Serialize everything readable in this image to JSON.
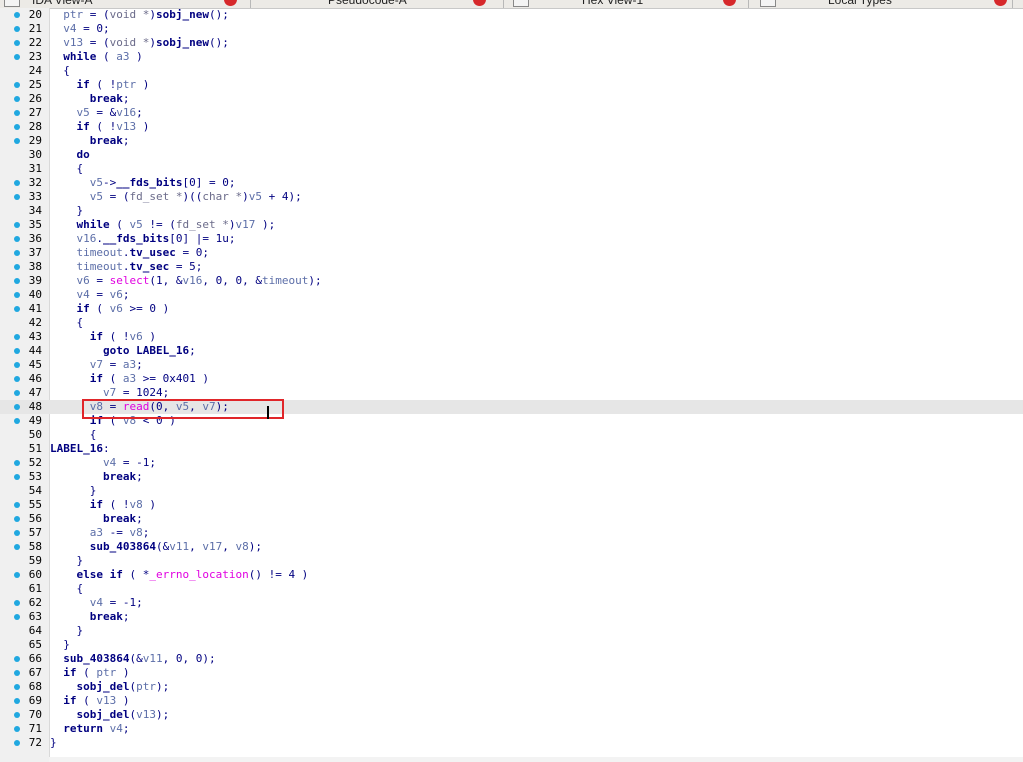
{
  "tabs": [
    {
      "label": "IDA View-A",
      "name": "tab-ida-view-a"
    },
    {
      "label": "Pseudocode-A",
      "name": "tab-pseudocode-a"
    },
    {
      "label": "Hex View-1",
      "name": "tab-hex-view-1"
    },
    {
      "label": "Local Types",
      "name": "tab-local-types"
    }
  ],
  "colors": {
    "gutter_dot": "#20a8e0",
    "highlight_box": "#e0262a",
    "code_text": "#000080",
    "variable": "#5c6ea8",
    "imported_function": "#e000e0",
    "current_line": "#e6e6e6"
  },
  "current_line": 48,
  "highlighted_line": 48,
  "code": [
    {
      "n": "20",
      "dot": true,
      "tokens": [
        [
          "sym",
          "  "
        ],
        [
          "var",
          "ptr"
        ],
        [
          "plain",
          " = ("
        ],
        [
          "typ",
          "void *"
        ],
        [
          "plain",
          ")"
        ],
        [
          "func",
          "sobj_new"
        ],
        [
          "plain",
          "();"
        ]
      ]
    },
    {
      "n": "21",
      "dot": true,
      "tokens": [
        [
          "plain",
          "  "
        ],
        [
          "var",
          "v4"
        ],
        [
          "plain",
          " = 0;"
        ]
      ]
    },
    {
      "n": "22",
      "dot": true,
      "tokens": [
        [
          "plain",
          "  "
        ],
        [
          "var",
          "v13"
        ],
        [
          "plain",
          " = ("
        ],
        [
          "typ",
          "void *"
        ],
        [
          "plain",
          ")"
        ],
        [
          "func",
          "sobj_new"
        ],
        [
          "plain",
          "();"
        ]
      ]
    },
    {
      "n": "23",
      "dot": true,
      "tokens": [
        [
          "plain",
          "  "
        ],
        [
          "kw",
          "while"
        ],
        [
          "plain",
          " ( "
        ],
        [
          "var",
          "a3"
        ],
        [
          "plain",
          " )"
        ]
      ]
    },
    {
      "n": "24",
      "dot": false,
      "tokens": [
        [
          "plain",
          "  {"
        ]
      ]
    },
    {
      "n": "25",
      "dot": true,
      "tokens": [
        [
          "plain",
          "    "
        ],
        [
          "kw",
          "if"
        ],
        [
          "plain",
          " ( !"
        ],
        [
          "var",
          "ptr"
        ],
        [
          "plain",
          " )"
        ]
      ]
    },
    {
      "n": "26",
      "dot": true,
      "tokens": [
        [
          "plain",
          "      "
        ],
        [
          "kw",
          "break"
        ],
        [
          "plain",
          ";"
        ]
      ]
    },
    {
      "n": "27",
      "dot": true,
      "tokens": [
        [
          "plain",
          "    "
        ],
        [
          "var",
          "v5"
        ],
        [
          "plain",
          " = &"
        ],
        [
          "var",
          "v16"
        ],
        [
          "plain",
          ";"
        ]
      ]
    },
    {
      "n": "28",
      "dot": true,
      "tokens": [
        [
          "plain",
          "    "
        ],
        [
          "kw",
          "if"
        ],
        [
          "plain",
          " ( !"
        ],
        [
          "var",
          "v13"
        ],
        [
          "plain",
          " )"
        ]
      ]
    },
    {
      "n": "29",
      "dot": true,
      "tokens": [
        [
          "plain",
          "      "
        ],
        [
          "kw",
          "break"
        ],
        [
          "plain",
          ";"
        ]
      ]
    },
    {
      "n": "30",
      "dot": false,
      "tokens": [
        [
          "plain",
          "    "
        ],
        [
          "kw",
          "do"
        ]
      ]
    },
    {
      "n": "31",
      "dot": false,
      "tokens": [
        [
          "plain",
          "    {"
        ]
      ]
    },
    {
      "n": "32",
      "dot": true,
      "tokens": [
        [
          "plain",
          "      "
        ],
        [
          "var",
          "v5"
        ],
        [
          "plain",
          "->"
        ],
        [
          "sym",
          "__fds_bits"
        ],
        [
          "plain",
          "[0] = 0;"
        ]
      ]
    },
    {
      "n": "33",
      "dot": true,
      "tokens": [
        [
          "plain",
          "      "
        ],
        [
          "var",
          "v5"
        ],
        [
          "plain",
          " = ("
        ],
        [
          "typ",
          "fd_set *"
        ],
        [
          "plain",
          ")(("
        ],
        [
          "typ",
          "char *"
        ],
        [
          "plain",
          ")"
        ],
        [
          "var",
          "v5"
        ],
        [
          "plain",
          " + 4);"
        ]
      ]
    },
    {
      "n": "34",
      "dot": false,
      "tokens": [
        [
          "plain",
          "    }"
        ]
      ]
    },
    {
      "n": "35",
      "dot": true,
      "tokens": [
        [
          "plain",
          "    "
        ],
        [
          "kw",
          "while"
        ],
        [
          "plain",
          " ( "
        ],
        [
          "var",
          "v5"
        ],
        [
          "plain",
          " != ("
        ],
        [
          "typ",
          "fd_set *"
        ],
        [
          "plain",
          ")"
        ],
        [
          "var",
          "v17"
        ],
        [
          "plain",
          " );"
        ]
      ]
    },
    {
      "n": "36",
      "dot": true,
      "tokens": [
        [
          "plain",
          "    "
        ],
        [
          "var",
          "v16"
        ],
        [
          "plain",
          "."
        ],
        [
          "sym",
          "__fds_bits"
        ],
        [
          "plain",
          "[0] |= 1u;"
        ]
      ]
    },
    {
      "n": "37",
      "dot": true,
      "tokens": [
        [
          "plain",
          "    "
        ],
        [
          "var",
          "timeout"
        ],
        [
          "plain",
          "."
        ],
        [
          "sym",
          "tv_usec"
        ],
        [
          "plain",
          " = 0;"
        ]
      ]
    },
    {
      "n": "38",
      "dot": true,
      "tokens": [
        [
          "plain",
          "    "
        ],
        [
          "var",
          "timeout"
        ],
        [
          "plain",
          "."
        ],
        [
          "sym",
          "tv_sec"
        ],
        [
          "plain",
          " = 5;"
        ]
      ]
    },
    {
      "n": "39",
      "dot": true,
      "tokens": [
        [
          "plain",
          "    "
        ],
        [
          "var",
          "v6"
        ],
        [
          "plain",
          " = "
        ],
        [
          "imp",
          "select"
        ],
        [
          "plain",
          "(1, &"
        ],
        [
          "var",
          "v16"
        ],
        [
          "plain",
          ", 0, 0, &"
        ],
        [
          "var",
          "timeout"
        ],
        [
          "plain",
          ");"
        ]
      ]
    },
    {
      "n": "40",
      "dot": true,
      "tokens": [
        [
          "plain",
          "    "
        ],
        [
          "var",
          "v4"
        ],
        [
          "plain",
          " = "
        ],
        [
          "var",
          "v6"
        ],
        [
          "plain",
          ";"
        ]
      ]
    },
    {
      "n": "41",
      "dot": true,
      "tokens": [
        [
          "plain",
          "    "
        ],
        [
          "kw",
          "if"
        ],
        [
          "plain",
          " ( "
        ],
        [
          "var",
          "v6"
        ],
        [
          "plain",
          " >= 0 )"
        ]
      ]
    },
    {
      "n": "42",
      "dot": false,
      "tokens": [
        [
          "plain",
          "    {"
        ]
      ]
    },
    {
      "n": "43",
      "dot": true,
      "tokens": [
        [
          "plain",
          "      "
        ],
        [
          "kw",
          "if"
        ],
        [
          "plain",
          " ( !"
        ],
        [
          "var",
          "v6"
        ],
        [
          "plain",
          " )"
        ]
      ]
    },
    {
      "n": "44",
      "dot": true,
      "tokens": [
        [
          "plain",
          "        "
        ],
        [
          "kw",
          "goto"
        ],
        [
          "plain",
          " "
        ],
        [
          "sym",
          "LABEL_16"
        ],
        [
          "plain",
          ";"
        ]
      ]
    },
    {
      "n": "45",
      "dot": true,
      "tokens": [
        [
          "plain",
          "      "
        ],
        [
          "var",
          "v7"
        ],
        [
          "plain",
          " = "
        ],
        [
          "var",
          "a3"
        ],
        [
          "plain",
          ";"
        ]
      ]
    },
    {
      "n": "46",
      "dot": true,
      "tokens": [
        [
          "plain",
          "      "
        ],
        [
          "kw",
          "if"
        ],
        [
          "plain",
          " ( "
        ],
        [
          "var",
          "a3"
        ],
        [
          "plain",
          " >= 0x401 )"
        ]
      ]
    },
    {
      "n": "47",
      "dot": true,
      "tokens": [
        [
          "plain",
          "        "
        ],
        [
          "var",
          "v7"
        ],
        [
          "plain",
          " = 1024;"
        ]
      ]
    },
    {
      "n": "48",
      "dot": true,
      "tokens": [
        [
          "plain",
          "      "
        ],
        [
          "var",
          "v8"
        ],
        [
          "plain",
          " = "
        ],
        [
          "imp",
          "read"
        ],
        [
          "plain",
          "(0, "
        ],
        [
          "var",
          "v5"
        ],
        [
          "plain",
          ", "
        ],
        [
          "var",
          "v7"
        ],
        [
          "plain",
          ");"
        ]
      ]
    },
    {
      "n": "49",
      "dot": true,
      "tokens": [
        [
          "plain",
          "      "
        ],
        [
          "kw",
          "if"
        ],
        [
          "plain",
          " ( "
        ],
        [
          "var",
          "v8"
        ],
        [
          "plain",
          " < 0 )"
        ]
      ]
    },
    {
      "n": "50",
      "dot": false,
      "tokens": [
        [
          "plain",
          "      {"
        ]
      ]
    },
    {
      "n": "51",
      "dot": false,
      "tokens": [
        [
          "sym",
          "LABEL_16"
        ],
        [
          "plain",
          ":"
        ]
      ]
    },
    {
      "n": "52",
      "dot": true,
      "tokens": [
        [
          "plain",
          "        "
        ],
        [
          "var",
          "v4"
        ],
        [
          "plain",
          " = -1;"
        ]
      ]
    },
    {
      "n": "53",
      "dot": true,
      "tokens": [
        [
          "plain",
          "        "
        ],
        [
          "kw",
          "break"
        ],
        [
          "plain",
          ";"
        ]
      ]
    },
    {
      "n": "54",
      "dot": false,
      "tokens": [
        [
          "plain",
          "      }"
        ]
      ]
    },
    {
      "n": "55",
      "dot": true,
      "tokens": [
        [
          "plain",
          "      "
        ],
        [
          "kw",
          "if"
        ],
        [
          "plain",
          " ( !"
        ],
        [
          "var",
          "v8"
        ],
        [
          "plain",
          " )"
        ]
      ]
    },
    {
      "n": "56",
      "dot": true,
      "tokens": [
        [
          "plain",
          "        "
        ],
        [
          "kw",
          "break"
        ],
        [
          "plain",
          ";"
        ]
      ]
    },
    {
      "n": "57",
      "dot": true,
      "tokens": [
        [
          "plain",
          "      "
        ],
        [
          "var",
          "a3"
        ],
        [
          "plain",
          " -= "
        ],
        [
          "var",
          "v8"
        ],
        [
          "plain",
          ";"
        ]
      ]
    },
    {
      "n": "58",
      "dot": true,
      "tokens": [
        [
          "plain",
          "      "
        ],
        [
          "func",
          "sub_403864"
        ],
        [
          "plain",
          "(&"
        ],
        [
          "var",
          "v11"
        ],
        [
          "plain",
          ", "
        ],
        [
          "var",
          "v17"
        ],
        [
          "plain",
          ", "
        ],
        [
          "var",
          "v8"
        ],
        [
          "plain",
          ");"
        ]
      ]
    },
    {
      "n": "59",
      "dot": false,
      "tokens": [
        [
          "plain",
          "    }"
        ]
      ]
    },
    {
      "n": "60",
      "dot": true,
      "tokens": [
        [
          "plain",
          "    "
        ],
        [
          "kw",
          "else if"
        ],
        [
          "plain",
          " ( *"
        ],
        [
          "imp",
          "_errno_location"
        ],
        [
          "plain",
          "() != 4 )"
        ]
      ]
    },
    {
      "n": "61",
      "dot": false,
      "tokens": [
        [
          "plain",
          "    {"
        ]
      ]
    },
    {
      "n": "62",
      "dot": true,
      "tokens": [
        [
          "plain",
          "      "
        ],
        [
          "var",
          "v4"
        ],
        [
          "plain",
          " = -1;"
        ]
      ]
    },
    {
      "n": "63",
      "dot": true,
      "tokens": [
        [
          "plain",
          "      "
        ],
        [
          "kw",
          "break"
        ],
        [
          "plain",
          ";"
        ]
      ]
    },
    {
      "n": "64",
      "dot": false,
      "tokens": [
        [
          "plain",
          "    }"
        ]
      ]
    },
    {
      "n": "65",
      "dot": false,
      "tokens": [
        [
          "plain",
          "  }"
        ]
      ]
    },
    {
      "n": "66",
      "dot": true,
      "tokens": [
        [
          "plain",
          "  "
        ],
        [
          "func",
          "sub_403864"
        ],
        [
          "plain",
          "(&"
        ],
        [
          "var",
          "v11"
        ],
        [
          "plain",
          ", 0, 0);"
        ]
      ]
    },
    {
      "n": "67",
      "dot": true,
      "tokens": [
        [
          "plain",
          "  "
        ],
        [
          "kw",
          "if"
        ],
        [
          "plain",
          " ( "
        ],
        [
          "var",
          "ptr"
        ],
        [
          "plain",
          " )"
        ]
      ]
    },
    {
      "n": "68",
      "dot": true,
      "tokens": [
        [
          "plain",
          "    "
        ],
        [
          "func",
          "sobj_del"
        ],
        [
          "plain",
          "("
        ],
        [
          "var",
          "ptr"
        ],
        [
          "plain",
          ");"
        ]
      ]
    },
    {
      "n": "69",
      "dot": true,
      "tokens": [
        [
          "plain",
          "  "
        ],
        [
          "kw",
          "if"
        ],
        [
          "plain",
          " ( "
        ],
        [
          "var",
          "v13"
        ],
        [
          "plain",
          " )"
        ]
      ]
    },
    {
      "n": "70",
      "dot": true,
      "tokens": [
        [
          "plain",
          "    "
        ],
        [
          "func",
          "sobj_del"
        ],
        [
          "plain",
          "("
        ],
        [
          "var",
          "v13"
        ],
        [
          "plain",
          ");"
        ]
      ]
    },
    {
      "n": "71",
      "dot": true,
      "tokens": [
        [
          "plain",
          "  "
        ],
        [
          "kw",
          "return"
        ],
        [
          "plain",
          " "
        ],
        [
          "var",
          "v4"
        ],
        [
          "plain",
          ";"
        ]
      ]
    },
    {
      "n": "72",
      "dot": true,
      "tokens": [
        [
          "plain",
          "}"
        ]
      ]
    }
  ]
}
